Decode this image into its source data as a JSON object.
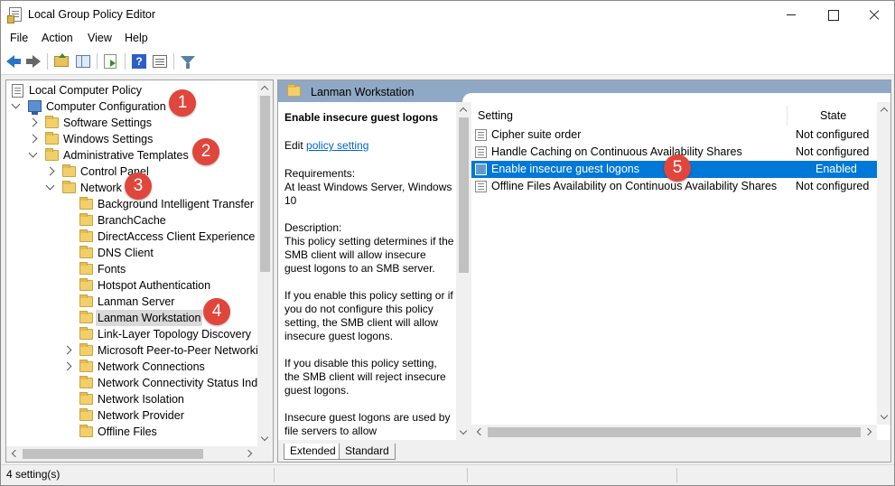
{
  "window": {
    "title": "Local Group Policy Editor"
  },
  "menu": [
    "File",
    "Action",
    "View",
    "Help"
  ],
  "toolbar": [
    "back-icon",
    "forward-icon",
    "up-folder-icon",
    "show-hide-tree-icon",
    "export-list-icon",
    "help-icon",
    "properties-icon",
    "filter-icon"
  ],
  "tree": {
    "items": [
      {
        "label": "Local Computer Policy"
      },
      {
        "label": "Computer Configuration"
      },
      {
        "label": "Software Settings"
      },
      {
        "label": "Windows Settings"
      },
      {
        "label": "Administrative Templates"
      },
      {
        "label": "Control Panel"
      },
      {
        "label": "Network"
      },
      {
        "label": "Background Intelligent Transfer Se"
      },
      {
        "label": "BranchCache"
      },
      {
        "label": "DirectAccess Client Experience Set"
      },
      {
        "label": "DNS Client"
      },
      {
        "label": "Fonts"
      },
      {
        "label": "Hotspot Authentication"
      },
      {
        "label": "Lanman Server"
      },
      {
        "label": "Lanman Workstation"
      },
      {
        "label": "Link-Layer Topology Discovery"
      },
      {
        "label": "Microsoft Peer-to-Peer Networkin"
      },
      {
        "label": "Network Connections"
      },
      {
        "label": "Network Connectivity Status Indic"
      },
      {
        "label": "Network Isolation"
      },
      {
        "label": "Network Provider"
      },
      {
        "label": "Offline Files"
      }
    ]
  },
  "right": {
    "header_title": "Lanman Workstation",
    "desc_title": "Enable insecure guest logons",
    "desc_edit_prefix": "Edit",
    "desc_edit_link": "policy setting",
    "desc_body": "Requirements:\nAt least Windows Server, Windows 10\n\nDescription:\nThis policy setting determines if the SMB client will allow insecure guest logons to an SMB server.\n\nIf you enable this policy setting or if you do not configure this policy setting, the SMB client will allow insecure guest logons.\n\nIf you disable this policy setting, the SMB client will reject insecure guest logons.\n\nInsecure guest logons are used by file servers to allow unauthenticated access to shared",
    "columns": {
      "setting": "Setting",
      "state": "State"
    },
    "rows": [
      {
        "setting": "Cipher suite order",
        "state": "Not configured"
      },
      {
        "setting": "Handle Caching on Continuous Availability Shares",
        "state": "Not configured"
      },
      {
        "setting": "Enable insecure guest logons",
        "state": "Enabled"
      },
      {
        "setting": "Offline Files Availability on Continuous Availability Shares",
        "state": "Not configured"
      }
    ],
    "tabs": [
      "Extended",
      "Standard"
    ]
  },
  "status": {
    "text": "4 setting(s)"
  },
  "callouts": [
    "1",
    "2",
    "3",
    "4",
    "5"
  ],
  "colors": {
    "selection": "#0078d7",
    "header": "#8fa8c6",
    "callout": "#e0463b"
  }
}
